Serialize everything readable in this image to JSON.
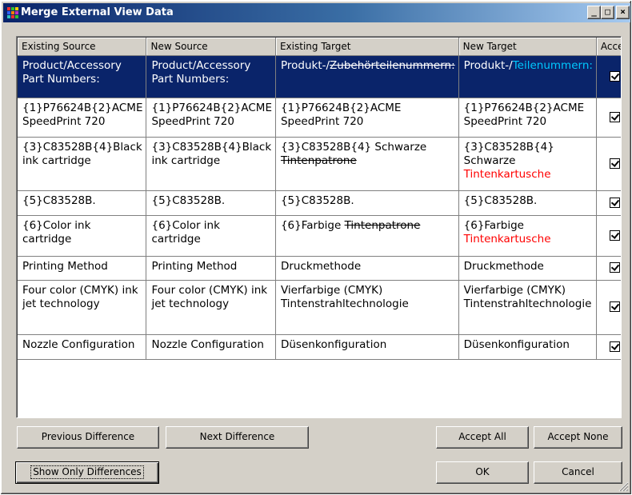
{
  "window": {
    "title": "Merge External View Data",
    "controls": {
      "minimize": "_",
      "maximize": "□",
      "close": "×"
    }
  },
  "grid": {
    "columns": [
      "Existing Source",
      "New Source",
      "Existing Target",
      "New Target",
      "Accept"
    ],
    "rows": [
      {
        "existing_source": "Product/Accessory Part Numbers:",
        "new_source": "Product/Accessory Part Numbers:",
        "existing_target": {
          "plain": "Produkt-/",
          "deleted": "Zubehörteilenummern:"
        },
        "new_target": {
          "plain": "Produkt-/",
          "inserted": "Teilenummern:"
        },
        "accept": true,
        "selected": true
      },
      {
        "existing_source": "{1}P76624B{2}ACME SpeedPrint 720",
        "new_source": "{1}P76624B{2}ACME SpeedPrint 720",
        "existing_target": {
          "plain": "{1}P76624B{2}ACME SpeedPrint 720"
        },
        "new_target": {
          "plain": "{1}P76624B{2}ACME SpeedPrint 720"
        },
        "accept": true
      },
      {
        "existing_source": "{3}C83528B{4}Black ink cartridge",
        "new_source": "{3}C83528B{4}Black ink cartridge",
        "existing_target": {
          "plain": "{3}C83528B{4} Schwarze ",
          "deleted": "Tintenpatrone"
        },
        "new_target": {
          "plain": "{3}C83528B{4} Schwarze ",
          "inserted": "Tintenkartusche"
        },
        "accept": true
      },
      {
        "existing_source": "{5}C83528B.",
        "new_source": "{5}C83528B.",
        "existing_target": {
          "plain": "{5}C83528B."
        },
        "new_target": {
          "plain": "{5}C83528B."
        },
        "accept": true
      },
      {
        "existing_source": "{6}Color ink cartridge",
        "new_source": "{6}Color ink cartridge",
        "existing_target": {
          "plain": "{6}Farbige ",
          "deleted": "Tintenpatrone"
        },
        "new_target": {
          "plain": "{6}Farbige ",
          "inserted": "Tintenkartusche"
        },
        "accept": true
      },
      {
        "existing_source": "Printing Method",
        "new_source": "Printing Method",
        "existing_target": {
          "plain": "Druckmethode"
        },
        "new_target": {
          "plain": "Druckmethode"
        },
        "accept": true
      },
      {
        "existing_source": "Four color (CMYK) ink jet technology",
        "new_source": "Four color (CMYK) ink jet technology",
        "existing_target": {
          "plain": "Vierfarbige (CMYK) Tintenstrahltechnologie"
        },
        "new_target": {
          "plain": "Vierfarbige (CMYK) Tintenstrahltechnologie"
        },
        "accept": true
      },
      {
        "existing_source": "Nozzle Configuration",
        "new_source": "Nozzle Configuration",
        "existing_target": {
          "plain": "Düsenkonfiguration"
        },
        "new_target": {
          "plain": "Düsenkonfiguration"
        },
        "accept": true
      }
    ]
  },
  "buttons": {
    "previous_difference": "Previous Difference",
    "next_difference": "Next Difference",
    "accept_all": "Accept All",
    "accept_none": "Accept None",
    "show_only_differences": "Show Only Differences",
    "ok": "OK",
    "cancel": "Cancel"
  },
  "colors": {
    "selection": "#0a246a",
    "inserted_text": "#ff0000",
    "inserted_text_selected": "#00c8ff",
    "title_gradient_start": "#0a246a",
    "title_gradient_end": "#a6caf0"
  }
}
